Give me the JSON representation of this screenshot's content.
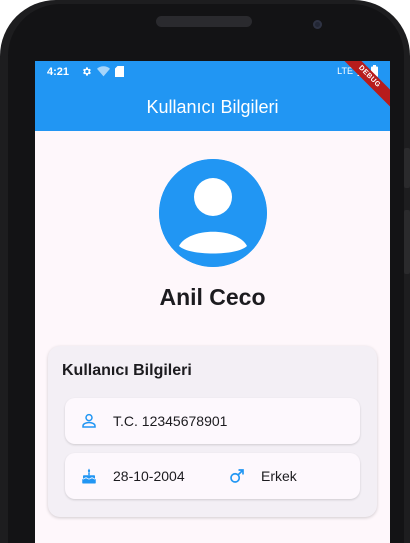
{
  "status_bar": {
    "time": "4:21",
    "network": "LTE",
    "icons": [
      "gear-icon",
      "wifi-icon",
      "sim-card-icon",
      "signal-icon",
      "battery-icon"
    ]
  },
  "app_bar": {
    "title": "Kullanıcı Bilgileri",
    "debug_banner": "DEBUG",
    "color": "#2196f3"
  },
  "profile": {
    "name": "Anil Ceco",
    "avatar_icon": "account-circle-icon"
  },
  "info_card": {
    "title": "Kullanıcı Bilgileri",
    "tc": "T.C. 12345678901",
    "birth_date": "28-10-2004",
    "gender": "Erkek"
  },
  "colors": {
    "accent": "#2196f3",
    "background": "#fef7fb",
    "card": "#f3eff5"
  }
}
